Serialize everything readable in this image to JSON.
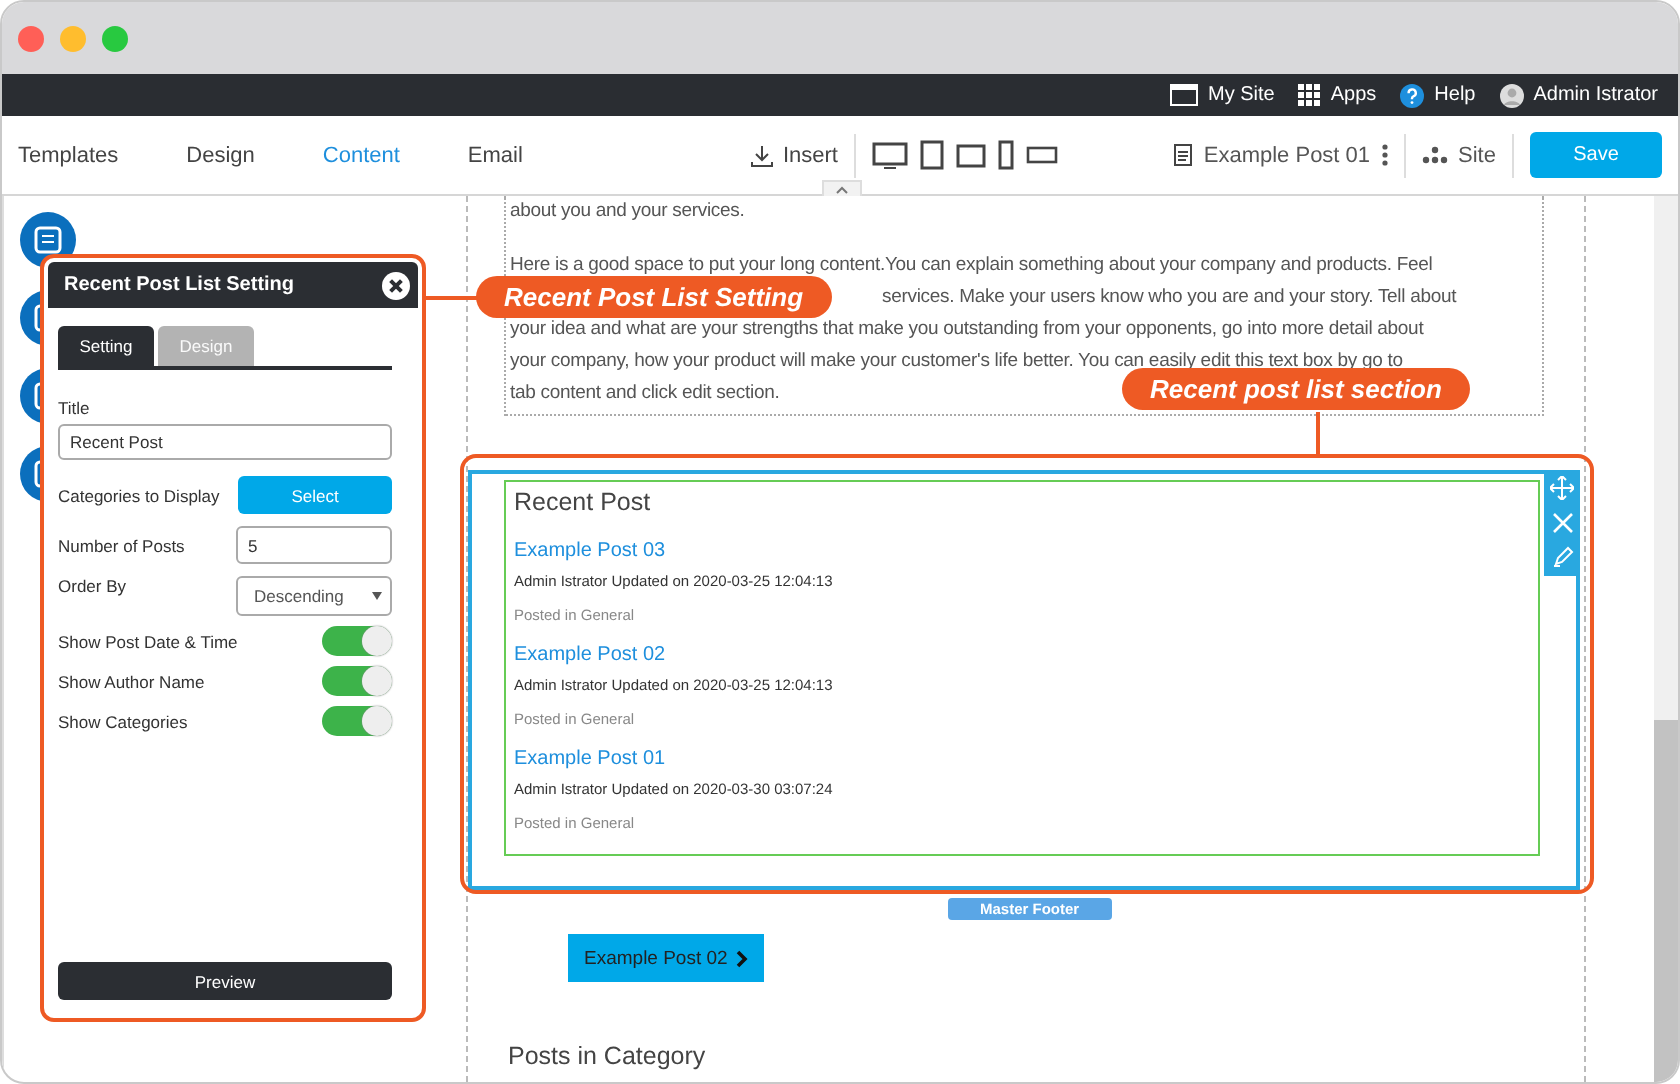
{
  "window": {
    "controls": [
      {
        "color": "#ff5f57"
      },
      {
        "color": "#ffbd2e"
      },
      {
        "color": "#28c940"
      }
    ]
  },
  "top_bar": {
    "items": [
      {
        "kind": "browser",
        "label": "My Site"
      },
      {
        "kind": "grid",
        "label": "Apps"
      },
      {
        "kind": "help",
        "label": "Help"
      },
      {
        "kind": "avatar",
        "label": "Admin Istrator"
      }
    ]
  },
  "toolbar": {
    "tabs": [
      {
        "label": "Templates",
        "selected": false
      },
      {
        "label": "Design",
        "selected": false
      },
      {
        "label": "Content",
        "selected": true
      },
      {
        "label": "Email",
        "selected": false
      }
    ],
    "insert": "Insert",
    "page": "Example Post 01",
    "site": "Site",
    "save": "Save"
  },
  "panel": {
    "title": "Recent Post List Setting",
    "tabs": [
      {
        "label": "Setting",
        "selected": true
      },
      {
        "label": "Design",
        "selected": false
      }
    ],
    "fields": [
      {
        "kind": "text",
        "label": "Title",
        "value": "Recent Post"
      },
      {
        "kind": "button",
        "label": "Categories to Display",
        "button": "Select"
      },
      {
        "kind": "input",
        "label": "Number of Posts",
        "value": "5"
      },
      {
        "kind": "select",
        "label": "Order By",
        "value": "Descending"
      },
      {
        "kind": "toggle",
        "label": "Show Post Date & Time",
        "on": true
      },
      {
        "kind": "toggle",
        "label": "Show Author Name",
        "on": true
      },
      {
        "kind": "toggle",
        "label": "Show Categories",
        "on": true
      }
    ],
    "preview": "Preview"
  },
  "canvas": {
    "intro": "about you and your services.",
    "paragraph_lines": [
      {
        "text": "Here is a good space to put your long content.You can explain something about your company and products. Feel",
        "hidden_start": false
      },
      {
        "text": "services. Make your users know who you are and your story. Tell about",
        "hidden_start": true
      },
      {
        "text": "your idea and what are your strengths that make you outstanding from your opponents, go into more detail about",
        "hidden_start": false
      },
      {
        "text": "your company, how your product will make your customer's life better. You can easily edit this text box by go to",
        "hidden_start": false
      },
      {
        "text": "tab content and click edit section.",
        "hidden_start": false
      }
    ],
    "section": {
      "heading": "Recent Post",
      "posts": [
        {
          "title": "Example Post 03",
          "meta": "Admin Istrator Updated on 2020-03-25 12:04:13",
          "category": "Posted in General"
        },
        {
          "title": "Example Post 02",
          "meta": "Admin Istrator Updated on 2020-03-25 12:04:13",
          "category": "Posted in General"
        },
        {
          "title": "Example Post 01",
          "meta": "Admin Istrator Updated on 2020-03-30 03:07:24",
          "category": "Posted in General"
        }
      ]
    },
    "footer_tag": "Master Footer",
    "nav_button": "Example Post 02",
    "heading": "Posts in Category"
  },
  "annotations": [
    {
      "kind": "panel",
      "text": "Recent Post List Setting"
    },
    {
      "kind": "section",
      "text": "Recent post list section"
    }
  ]
}
